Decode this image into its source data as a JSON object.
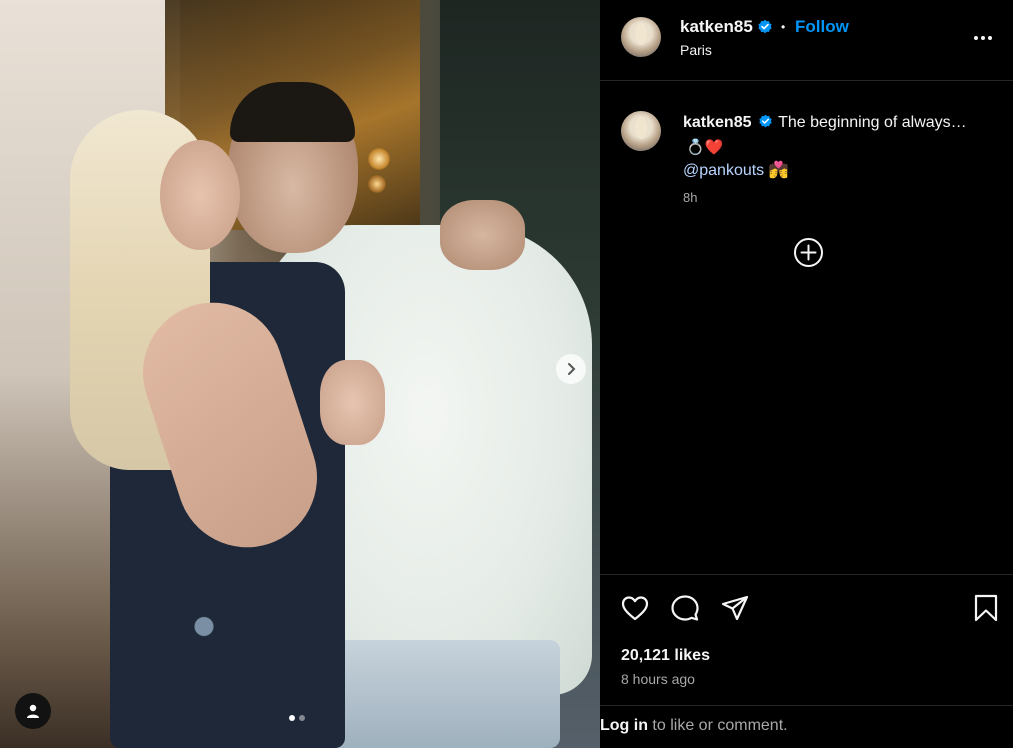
{
  "post": {
    "author": "katken85",
    "location": "Paris",
    "follow_label": "Follow",
    "separator": "•"
  },
  "caption": {
    "username": "katken85",
    "text": "The beginning of always…",
    "emoji_line": "💍❤️",
    "mention": "@pankouts",
    "mention_emoji": "💏",
    "time": "8h"
  },
  "stats": {
    "likes": "20,121 likes",
    "time_ago": "8 hours ago"
  },
  "login_prompt": {
    "link": "Log in",
    "rest": " to like or comment."
  },
  "carousel": {
    "current": 1,
    "total": 2
  },
  "icons": {
    "verified": "verified-badge-icon",
    "more": "more-options-icon",
    "like": "heart-icon",
    "comment": "comment-icon",
    "share": "share-icon",
    "save": "bookmark-icon",
    "next": "chevron-right-icon",
    "tag": "user-tag-icon",
    "load_more": "plus-circle-icon"
  },
  "colors": {
    "accent": "#0095f6",
    "background": "#000000",
    "text": "#f5f5f5",
    "muted": "#a8a8a8",
    "heart_emoji": "#ff3b73"
  }
}
